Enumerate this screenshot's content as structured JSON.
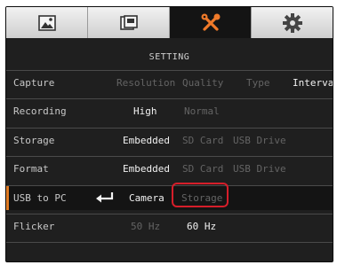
{
  "tabs": [
    {
      "icon": "image-icon"
    },
    {
      "icon": "album-icon"
    },
    {
      "icon": "tools-icon",
      "color": "#f07a2a"
    },
    {
      "icon": "gear-icon"
    }
  ],
  "title": "SETTING",
  "rows": [
    {
      "label": "Capture",
      "options": [
        "Resolution",
        "Quality",
        "Type",
        "Interval"
      ]
    },
    {
      "label": "Recording",
      "options": [
        "High",
        "Normal"
      ]
    },
    {
      "label": "Storage",
      "options": [
        "Embedded",
        "SD Card",
        "USB Drive"
      ]
    },
    {
      "label": "Format",
      "options": [
        "Embedded",
        "SD Card",
        "USB Drive"
      ]
    },
    {
      "label": "USB to PC",
      "enter_icon": "enter-icon",
      "options": [
        "Camera",
        "Storage"
      ]
    },
    {
      "label": "Flicker",
      "options": [
        "50 Hz",
        "60 Hz"
      ]
    }
  ],
  "colors": {
    "accent": "#e07a22",
    "highlight": "#d61e2a"
  }
}
